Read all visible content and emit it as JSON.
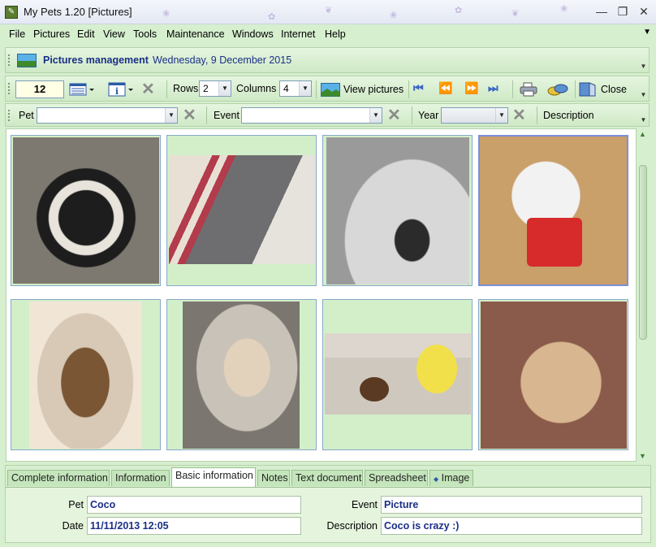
{
  "window": {
    "title": "My Pets 1.20  [Pictures]",
    "minimize": "—",
    "maximize": "❐",
    "close": "✕"
  },
  "menu": [
    "File",
    "Pictures",
    "Edit",
    "View",
    "Tools",
    "Maintenance",
    "Windows",
    "Internet",
    "Help"
  ],
  "header": {
    "title": "Pictures management",
    "date": "Wednesday, 9 December 2015"
  },
  "toolbar": {
    "count": "12",
    "rows_label": "Rows",
    "rows_value": "2",
    "columns_label": "Columns",
    "columns_value": "4",
    "view_pictures_label": "View pictures",
    "close_label": "Close"
  },
  "filters": {
    "pet_label": "Pet",
    "pet_value": "",
    "event_label": "Event",
    "event_value": "",
    "year_label": "Year",
    "year_value": "",
    "description_label": "Description"
  },
  "gallery": {
    "selected_index": 3,
    "photos": [
      {
        "subject": "black and white puppy on gray blanket",
        "colors": [
          "#7d7870",
          "#1d1d1d",
          "#e8e4dc"
        ]
      },
      {
        "subject": "gray dog lying on striped cushion",
        "colors": [
          "#e8e0d4",
          "#6e6e70",
          "#b23b4c"
        ]
      },
      {
        "subject": "close-up of white dog nose (grayscale)",
        "colors": [
          "#9a9a9a",
          "#d8d8d8",
          "#2b2b2b"
        ]
      },
      {
        "subject": "white dog with red monster toy",
        "colors": [
          "#c99f6a",
          "#f2f2f2",
          "#d72b2b"
        ]
      },
      {
        "subject": "fluffy brown dog on tiled floor",
        "colors": [
          "#d8c8b6",
          "#7a5634",
          "#f1e6d6"
        ]
      },
      {
        "subject": "dog wearing plastic cone collar",
        "colors": [
          "#c9c2b8",
          "#e2d2bc",
          "#7b7670"
        ]
      },
      {
        "subject": "plush toy dogs on tiled floor",
        "colors": [
          "#dcd6ce",
          "#f2e04a",
          "#5a3a22"
        ]
      },
      {
        "subject": "close-up of light tan dog face",
        "colors": [
          "#8a5a4a",
          "#d8b690",
          "#2a1c16"
        ]
      }
    ]
  },
  "tabs": [
    "Complete information",
    "Information",
    "Basic information",
    "Notes",
    "Text document",
    "Spreadsheet",
    "Image"
  ],
  "active_tab": "Basic information",
  "details": {
    "pet_label": "Pet",
    "pet_value": "Coco",
    "date_label": "Date",
    "date_value": "11/11/2013 12:05",
    "event_label": "Event",
    "event_value": "Picture",
    "description_label": "Description",
    "description_value": "Coco is crazy  :)"
  },
  "colors": {
    "background": "#d6efcf",
    "accent_text": "#1a2f87",
    "selection_border": "#7c8fd8"
  }
}
